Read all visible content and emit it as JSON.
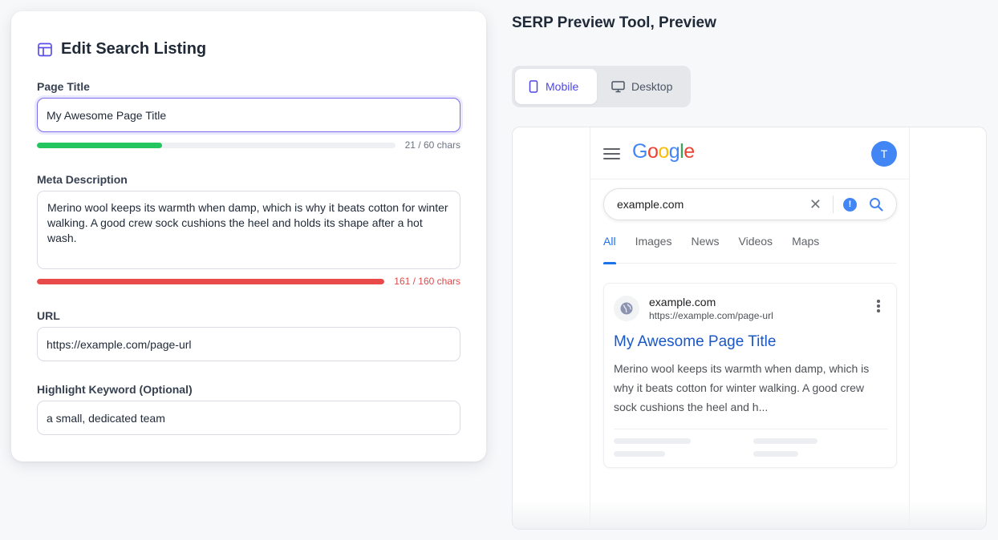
{
  "editor": {
    "heading": "Edit Search Listing",
    "page_title": {
      "label": "Page Title",
      "value": "My Awesome Page Title",
      "count": "21 / 60 chars",
      "fill_fraction": 0.35
    },
    "meta_description": {
      "label": "Meta Description",
      "value": "Merino wool keeps its warmth when damp, which is why it beats cotton for winter walking. A good crew sock cushions the heel and holds its shape after a hot wash.",
      "count": "161 / 160 chars",
      "fill_fraction": 1.0
    },
    "url": {
      "label": "URL",
      "value": "https://example.com/page-url"
    },
    "keyword": {
      "label": "Highlight Keyword (Optional)",
      "value": "a small, dedicated team"
    }
  },
  "preview": {
    "title": "SERP Preview Tool, Preview",
    "mode_mobile": "Mobile",
    "mode_desktop": "Desktop",
    "active_mode": "Mobile"
  },
  "serp": {
    "avatar_letter": "T",
    "query": "example.com",
    "tabs": [
      "All",
      "Images",
      "News",
      "Videos",
      "Maps"
    ],
    "active_tab": "All",
    "result": {
      "site_name": "example.com",
      "breadcrumb": "https://example.com/page-url",
      "title": "My Awesome Page Title",
      "snippet": "Merino wool keeps its warmth when damp, which is why it beats cotton for winter walking. A good crew sock cushions the heel and h..."
    }
  },
  "colors": {
    "accent": "#4f46e5",
    "progress_ok": "#22c55e",
    "progress_over": "#ef4444",
    "link_blue": "#1a57c7"
  },
  "icons": [
    "layout-icon",
    "mobile-icon",
    "desktop-icon",
    "hamburger-icon",
    "clear-icon",
    "lens-icon",
    "search-icon",
    "globe-icon",
    "kebab-icon"
  ]
}
